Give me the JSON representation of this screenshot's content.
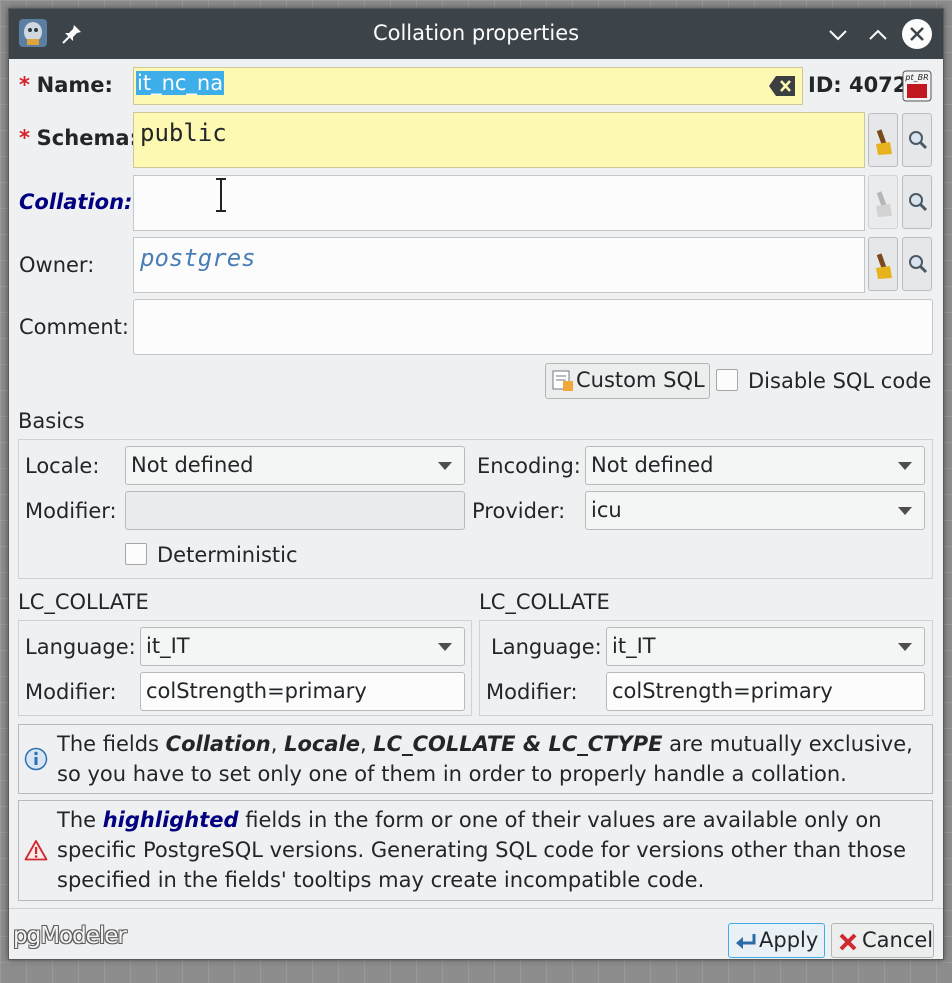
{
  "window": {
    "title": "Collation properties"
  },
  "form": {
    "name_label": "Name:",
    "name_value": "it_nc_na",
    "id_label": "ID: 4072",
    "schema_label": "Schema:",
    "schema_value": "public",
    "collation_label": "Collation:",
    "collation_value": "",
    "owner_label": "Owner:",
    "owner_value": "postgres",
    "comment_label": "Comment:",
    "comment_value": "",
    "required_marker": "*",
    "custom_sql_label": "Custom SQL",
    "disable_sql_label": "Disable SQL code"
  },
  "basics": {
    "title": "Basics",
    "locale_label": "Locale:",
    "locale_value": "Not defined",
    "encoding_label": "Encoding:",
    "encoding_value": "Not defined",
    "modifier_label": "Modifier:",
    "modifier_value": "",
    "provider_label": "Provider:",
    "provider_value": "icu",
    "deterministic_label": "Deterministic"
  },
  "lc_left": {
    "title": "LC_COLLATE",
    "language_label": "Language:",
    "language_value": "it_IT",
    "modifier_label": "Modifier:",
    "modifier_value": "colStrength=primary"
  },
  "lc_right": {
    "title": "LC_COLLATE",
    "language_label": "Language:",
    "language_value": "it_IT",
    "modifier_label": "Modifier:",
    "modifier_value": "colStrength=primary"
  },
  "info_msg": {
    "t1": "The fields ",
    "b1": "Collation",
    "t2": ", ",
    "b2": "Locale",
    "t3": ", ",
    "b3": "LC_COLLATE & LC_CTYPE",
    "t4": " are mutually exclusive, so you have to set only one of them in order to properly handle a collation."
  },
  "warn_msg": {
    "t1": "The ",
    "b1": "highlighted",
    "t2": " fields in the form or one of their values are available only on specific PostgreSQL versions. Generating SQL code for versions other than those specified in the fields' tooltips may create incompatible code."
  },
  "footer": {
    "brand": "pgModeler",
    "apply_label": "Apply",
    "cancel_label": "Cancel"
  },
  "colors": {
    "titlebar": "#3d4449",
    "required": "#da1f2c",
    "highlight": "#fdf9b2",
    "pseudo_blue": "#000080",
    "owner_text": "#4a7fb5"
  }
}
